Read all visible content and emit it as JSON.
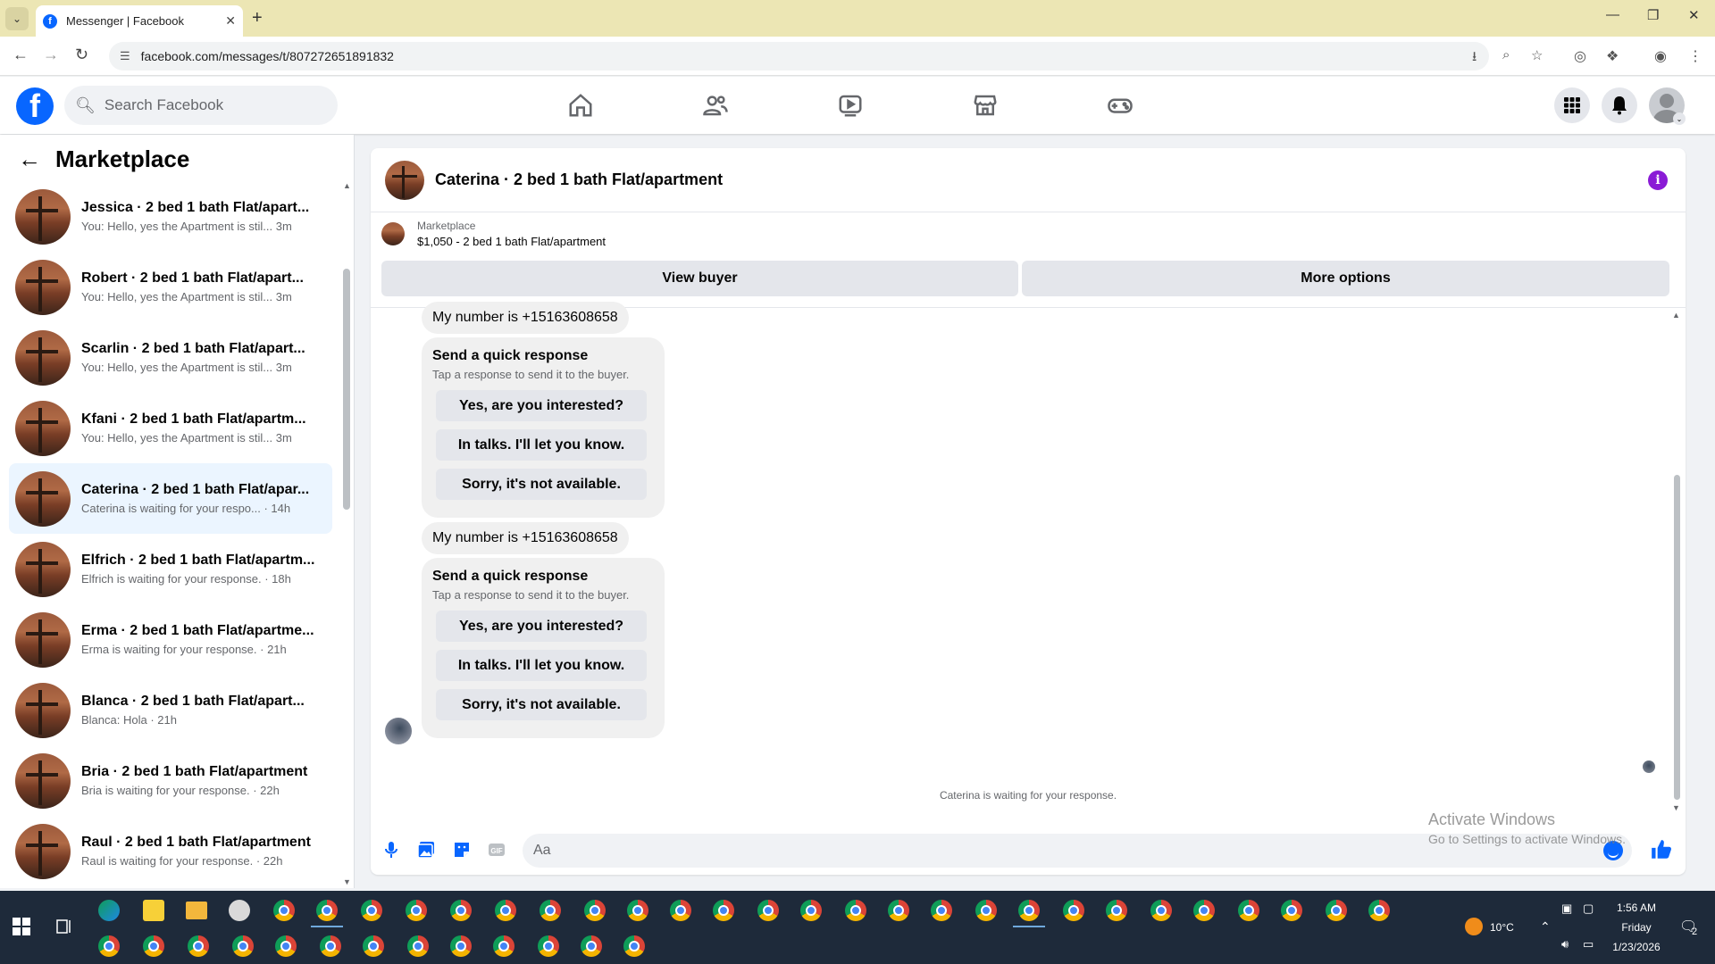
{
  "browser": {
    "tab_title": "Messenger | Facebook",
    "url": "facebook.com/messages/t/807272651891832"
  },
  "fb": {
    "search_placeholder": "Search Facebook"
  },
  "sidebar": {
    "title": "Marketplace",
    "conversations": [
      {
        "name": "Jessica · 2 bed 1 bath Flat/apart...",
        "preview": "You: Hello, yes the Apartment is stil... 3m"
      },
      {
        "name": "Robert · 2 bed 1 bath Flat/apart...",
        "preview": "You: Hello, yes the Apartment is stil... 3m"
      },
      {
        "name": "Scarlin · 2 bed 1 bath Flat/apart...",
        "preview": "You: Hello, yes the Apartment is stil... 3m"
      },
      {
        "name": "Kfani · 2 bed 1 bath Flat/apartm...",
        "preview": "You: Hello, yes the Apartment is stil... 3m"
      },
      {
        "name": "Caterina · 2 bed 1 bath Flat/apar...",
        "preview": "Caterina is waiting for your respo... · 14h"
      },
      {
        "name": "Elfrich · 2 bed 1 bath Flat/apartm...",
        "preview": "Elfrich is waiting for your response. · 18h"
      },
      {
        "name": "Erma · 2 bed 1 bath Flat/apartme...",
        "preview": "Erma is waiting for your response. · 21h"
      },
      {
        "name": "Blanca · 2 bed 1 bath Flat/apart...",
        "preview": "Blanca: Hola · 21h"
      },
      {
        "name": "Bria · 2 bed 1 bath Flat/apartment",
        "preview": "Bria is waiting for your response. · 22h"
      },
      {
        "name": "Raul · 2 bed 1 bath Flat/apartment",
        "preview": "Raul is waiting for your response. · 22h"
      }
    ]
  },
  "chat": {
    "title": "Caterina · 2 bed 1 bath Flat/apartment",
    "listing_label": "Marketplace",
    "listing_value": "$1,050 - 2 bed 1 bath Flat/apartment",
    "view_buyer": "View buyer",
    "more_options": "More options",
    "messages": [
      {
        "number": "My number is +15163608658",
        "qr_title": "Send a quick response",
        "qr_sub": "Tap a response to send it to the buyer.",
        "qr_buttons": [
          "Yes, are you interested?",
          "In talks. I'll let you know.",
          "Sorry, it's not available."
        ]
      },
      {
        "number": "My number is +15163608658",
        "qr_title": "Send a quick response",
        "qr_sub": "Tap a response to send it to the buyer.",
        "qr_buttons": [
          "Yes, are you interested?",
          "In talks. I'll let you know.",
          "Sorry, it's not available."
        ]
      }
    ],
    "waiting": "Caterina is waiting for your response.",
    "composer_placeholder": "Aa"
  },
  "watermark": {
    "line1": "Activate Windows",
    "line2": "Go to Settings to activate Windows."
  },
  "taskbar": {
    "weather": "10°C",
    "time": "1:56 AM",
    "day": "Friday",
    "date": "1/23/2026",
    "notifications": "2"
  },
  "colors": {
    "facebook_blue": "#0866ff",
    "info_purple": "#8a1bd6",
    "active_row": "#ebf5ff"
  }
}
